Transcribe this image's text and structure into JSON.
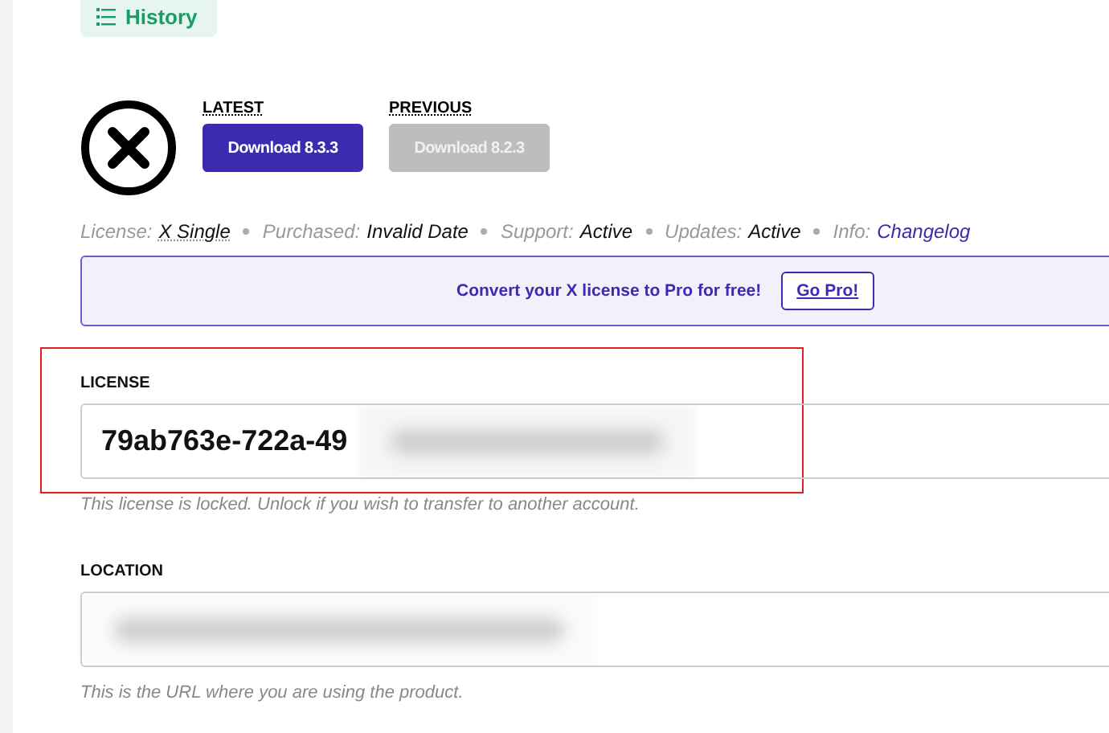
{
  "history_button": {
    "label": "History"
  },
  "downloads": [
    {
      "heading": "LATEST",
      "button": "Download 8.3.3",
      "disabled": false
    },
    {
      "heading": "PREVIOUS",
      "button": "Download 8.2.3",
      "disabled": true
    }
  ],
  "info": [
    {
      "label": "License:",
      "value": "X Single",
      "kind": "abbr"
    },
    {
      "label": "Purchased:",
      "value": "Invalid Date",
      "kind": "text"
    },
    {
      "label": "Support:",
      "value": "Active",
      "kind": "text"
    },
    {
      "label": "Updates:",
      "value": "Active",
      "kind": "text"
    },
    {
      "label": "Info:",
      "value": "Changelog",
      "kind": "link"
    }
  ],
  "banner": {
    "text": "Convert your X license to Pro for free!",
    "button": "Go Pro!"
  },
  "fields": [
    {
      "label": "LICENSE",
      "value": "79ab763e-722a-49",
      "help": "This license is locked. Unlock if you wish to transfer to another account.",
      "highlighted": true
    },
    {
      "label": "LOCATION",
      "help": "This is the URL where you are using the product.",
      "highlighted": false
    }
  ]
}
